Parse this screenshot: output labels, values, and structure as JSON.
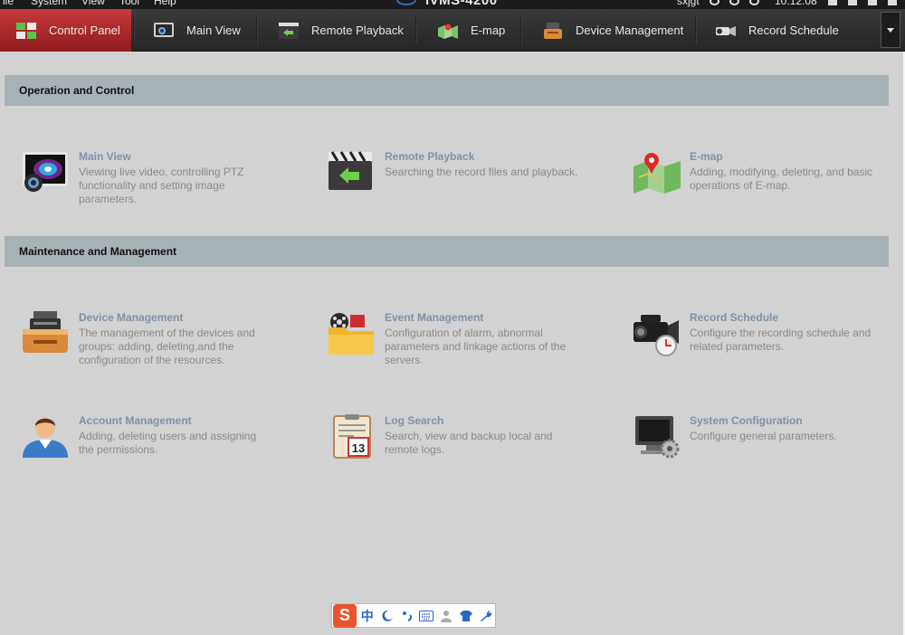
{
  "menubar": {
    "items": [
      "ile",
      "System",
      "View",
      "Tool",
      "Help"
    ],
    "title": "iVMS-4200",
    "user": "sxjgt",
    "clock": "10:12:08"
  },
  "tabs": [
    {
      "label": "Control Panel",
      "icon": "control-panel-icon",
      "active": true
    },
    {
      "label": "Main View",
      "icon": "main-view-icon",
      "active": false
    },
    {
      "label": "Remote Playback",
      "icon": "remote-playback-icon",
      "active": false
    },
    {
      "label": "E-map",
      "icon": "emap-icon",
      "active": false
    },
    {
      "label": "Device Management",
      "icon": "device-management-icon",
      "active": false
    },
    {
      "label": "Record Schedule",
      "icon": "record-schedule-icon",
      "active": false
    }
  ],
  "sections": {
    "operation": {
      "title": "Operation and Control",
      "cards": [
        {
          "title": "Main View",
          "desc": "Viewing live video, controlling PTZ functionality and setting image parameters."
        },
        {
          "title": "Remote Playback",
          "desc": "Searching the record files and playback."
        },
        {
          "title": "E-map",
          "desc": "Adding, modifying, deleting, and basic operations of E-map."
        }
      ]
    },
    "maintenance": {
      "title": "Maintenance and Management",
      "cards": [
        {
          "title": "Device Management",
          "desc": "The management of the devices and groups: adding, deleting,and the configuration of the resources."
        },
        {
          "title": "Event Management",
          "desc": "Configuration of alarm, abnormal parameters and linkage actions of the servers."
        },
        {
          "title": "Record Schedule",
          "desc": "Configure the recording schedule and related parameters."
        },
        {
          "title": "Account Management",
          "desc": "Adding, deleting users and assigning the permissions."
        },
        {
          "title": "Log Search",
          "desc": "Search, view and backup local and remote logs."
        },
        {
          "title": "System Configuration",
          "desc": "Configure general parameters."
        }
      ]
    }
  },
  "ime": {
    "logo": "S",
    "mode": "中",
    "icons": [
      "moon-icon",
      "punctuation-icon",
      "keyboard-icon",
      "user-icon",
      "skin-icon",
      "wrench-icon"
    ]
  },
  "colors": {
    "active_tab": "#b52d2d",
    "section_bar": "#a7b2b6",
    "card_title": "#7f93a8",
    "card_desc": "#8a8a8a"
  }
}
